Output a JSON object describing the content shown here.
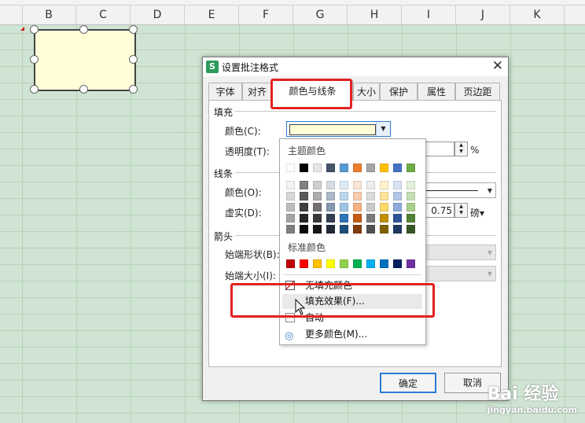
{
  "sheet": {
    "columns": [
      "B",
      "C",
      "D",
      "E",
      "F",
      "G",
      "H",
      "I",
      "J",
      "K"
    ]
  },
  "dialog": {
    "logo": "S",
    "title": "设置批注格式",
    "tabs": [
      "字体",
      "对齐",
      "颜色与线条",
      "大小",
      "保护",
      "属性",
      "页边距"
    ],
    "active_tab": "颜色与线条",
    "fill": {
      "section": "填充",
      "color_label": "颜色(C):",
      "color_value": "#FFFED9",
      "transparency_label": "透明度(T):",
      "transparency_unit": "%"
    },
    "line": {
      "section": "线条",
      "color_label": "颜色(O):",
      "dash_label": "虚实(D):",
      "weight_value": "0.75",
      "weight_unit": "磅▾"
    },
    "arrow": {
      "section": "箭头",
      "start_style_label": "始端形状(B):",
      "start_size_label": "始端大小(I):"
    },
    "ok_label": "确定",
    "cancel_label": "取消"
  },
  "dropdown": {
    "theme_header": "主题颜色",
    "standard_header": "标准颜色",
    "theme_top": [
      "#ffffff",
      "#000000",
      "#e7e6e6",
      "#44546a",
      "#5b9bd5",
      "#ed7d31",
      "#a5a5a5",
      "#ffc000",
      "#4472c4",
      "#70ad47"
    ],
    "theme_shades": [
      [
        "#f2f2f2",
        "#7f7f7f",
        "#d0cece",
        "#d6dce4",
        "#deebf6",
        "#fbe5d5",
        "#ededed",
        "#fff2cc",
        "#d9e2f3",
        "#e2efd9"
      ],
      [
        "#d8d8d8",
        "#595959",
        "#aeabab",
        "#adb9ca",
        "#bdd7ee",
        "#f7cbac",
        "#dbdbdb",
        "#fee599",
        "#b4c6e7",
        "#c5e0b3"
      ],
      [
        "#bfbfbf",
        "#3f3f3f",
        "#757070",
        "#8496b0",
        "#9dc3e6",
        "#f4b183",
        "#c9c9c9",
        "#ffd966",
        "#8eaadb",
        "#a8d08d"
      ],
      [
        "#a5a5a5",
        "#262626",
        "#3a3838",
        "#333f50",
        "#2e75b5",
        "#c55a11",
        "#7b7b7b",
        "#bf9000",
        "#2f5496",
        "#538135"
      ],
      [
        "#7f7f7f",
        "#0c0c0c",
        "#171616",
        "#222a35",
        "#1e4e79",
        "#833c0b",
        "#525252",
        "#7f6000",
        "#1f3864",
        "#375623"
      ]
    ],
    "standard": [
      "#c00000",
      "#ff0000",
      "#ffc000",
      "#ffff00",
      "#92d050",
      "#00b050",
      "#00b0f0",
      "#0070c0",
      "#002060",
      "#7030a0"
    ],
    "items": [
      {
        "label": "无填充颜色"
      },
      {
        "label": "填充效果(F)..."
      },
      {
        "label": "自动"
      },
      {
        "label": "更多颜色(M)..."
      }
    ]
  },
  "watermark": {
    "brand": "Bai 经验",
    "url": "jingyan.baidu.com"
  }
}
